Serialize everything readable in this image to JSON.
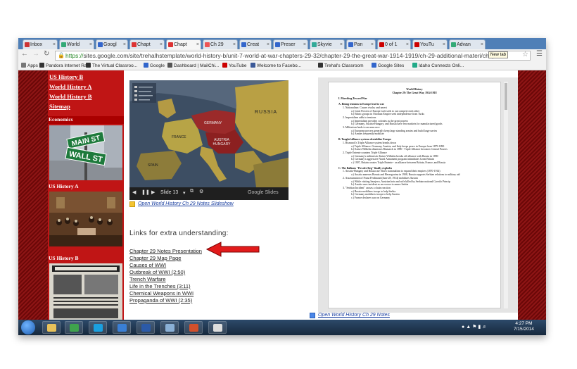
{
  "tabs": [
    {
      "label": "Inbox",
      "color": "#c33"
    },
    {
      "label": "World",
      "color": "#3a7"
    },
    {
      "label": "Googl",
      "color": "#36c"
    },
    {
      "label": "Chapt",
      "color": "#d33"
    },
    {
      "label": "Chapt",
      "color": "#d33"
    },
    {
      "label": "Ch 29",
      "color": "#e55"
    },
    {
      "label": "Creat",
      "color": "#36c"
    },
    {
      "label": "Preser",
      "color": "#36c"
    },
    {
      "label": "Skyvie",
      "color": "#3a9"
    },
    {
      "label": "Pan",
      "color": "#36c"
    },
    {
      "label": "0 of 1",
      "color": "#c00"
    },
    {
      "label": "YouTu",
      "color": "#c00"
    },
    {
      "label": "Advan",
      "color": "#3a7"
    }
  ],
  "newtab_tip": "New tab",
  "address": {
    "scheme": "https://",
    "rest": "sites.google.com/site/trehalhstemplate/world-history-b/unit-7-world-at-war-chapters-29-32/chapter-29-the-great-war-1914-1919/ch-29-additional-materi/chap"
  },
  "bookmarks": [
    {
      "label": "Apps",
      "color": "#777"
    },
    {
      "label": "Pandora Internet Ra...",
      "color": "#333"
    },
    {
      "label": "The Virtual Classroo...",
      "color": "#333"
    },
    {
      "label": "Google",
      "color": "#36c"
    },
    {
      "label": "Dashboard | MailChi...",
      "color": "#555"
    },
    {
      "label": "YouTube",
      "color": "#c00"
    },
    {
      "label": "Welcome to Facebo...",
      "color": "#3b5998"
    },
    {
      "label": "Trehal's Classroom",
      "color": "#333"
    },
    {
      "label": "Google Sites",
      "color": "#36c"
    },
    {
      "label": "Idaho Connects Onli...",
      "color": "#2a8"
    }
  ],
  "sidebar": {
    "links": [
      "US History B",
      "World History A",
      "World History B",
      "Sitemap"
    ],
    "sections": [
      {
        "title": "Economics",
        "image": "wall-street-sign"
      },
      {
        "title": "US History A",
        "image": "declaration-painting"
      },
      {
        "title": "US History B",
        "image": "historical-newspaper"
      }
    ]
  },
  "slides": {
    "map_labels": [
      "RUSSIA",
      "FRANCE",
      "SPAIN",
      "GERMANY",
      "AUSTRIA HUNGARY"
    ],
    "slide_indicator": "Slide 13",
    "brand": "Google Slides",
    "link_text": "Open World History Ch 29 Notes Slideshow"
  },
  "links_heading": "Links for extra understanding:",
  "links": [
    "Chapter 29 Notes Presentation",
    "Chapter 29 Map Page",
    "Causes of WWI",
    "Outbreak of WWI (2:50)",
    "Trench Warfare",
    "Life in the Trenches (3:11)",
    "Chemical Weapons in WWI",
    "Propaganda of WWI (2:35)"
  ],
  "doc": {
    "title1": "World History",
    "title2": "Chapter 29: The Great War, 1914-1918",
    "lines": [
      "I. Marching Toward War",
      "A. Rising tensions in Europe lead to war",
      "1. Nationalism: Causes rivalry and unrest",
      "a.) Great Powers of Europe each seek to out compete each other",
      "b.) Ethnic groups in Ottoman Empire seek independence from Turks",
      "2. Imperialism adds to tensions",
      "a.) Imperialism provides colonies as the great powers",
      "b.) Germany, Austria-Hungary, and Russia have few markets for manufactured goods",
      "3. Militarism leads to an arms race",
      "a.) European powers generally keep large standing armies and build large navies",
      "b.) Armies frequently mobilize",
      "B. Tangled alliance systems destabilize Europe",
      "1. Bismarck's Triple Alliance system breaks down",
      "a.) Triple Alliance: Germany, Austria, and Italy keeps peace in Europe from 1879-1890",
      "b.) Kaiser Wilhelm dismisses Bismarck in 1890 - Triple Alliance becomes Central Powers",
      "2. Triple Entente counters Triple Alliance",
      "a.) Germany's militaristic Kaiser Wilhelm breaks off alliance with Russia in 1890",
      "b.) Germany's aggressive Naval Armament program intimidates Great Britain",
      "c.) 1907, Britain creates Triple Entente - an alliance between Britain, France, and Russia",
      "C. The Balkans \"Powder Keg\" finally explodes",
      "1. Austria-Hungary and Russia use Slavic nationalism to expand their empires (1870-1914)",
      "a.) Austria annexes Bosnia and Herzegovina in 1908, Russia supports Serbian relations to military aid",
      "2. Assassination of Franz Ferdinand (June 28, 1914) mobilizes Austria",
      "a.) While visiting Sarajevo, Austrian heir and wife killed by Serbian national Gavrilo Princip",
      "b.) Austria uses incident as an excuse to annex Serbia",
      "3. \"Serbian Incident\" causes a chain reaction",
      "a.) Russia mobilizes troops to help Serbia",
      "b.) Germany mobilizes troops to help Austria",
      "c.) France declares war on Germany"
    ],
    "link_text": "Open World History Ch 29 Notes"
  },
  "taskbar": {
    "apps": [
      {
        "name": "file-explorer",
        "color": "#e8c25a"
      },
      {
        "name": "chrome",
        "color": "#3fa34d"
      },
      {
        "name": "skype",
        "color": "#1aa0e0"
      },
      {
        "name": "ie",
        "color": "#3a7fd5"
      },
      {
        "name": "word",
        "color": "#2b5aa8"
      },
      {
        "name": "photos",
        "color": "#8ab0d6"
      },
      {
        "name": "powerpoint",
        "color": "#d2502c"
      },
      {
        "name": "blank-window",
        "color": "#dddddd"
      }
    ],
    "time": "4:27 PM",
    "date": "7/15/2014"
  }
}
